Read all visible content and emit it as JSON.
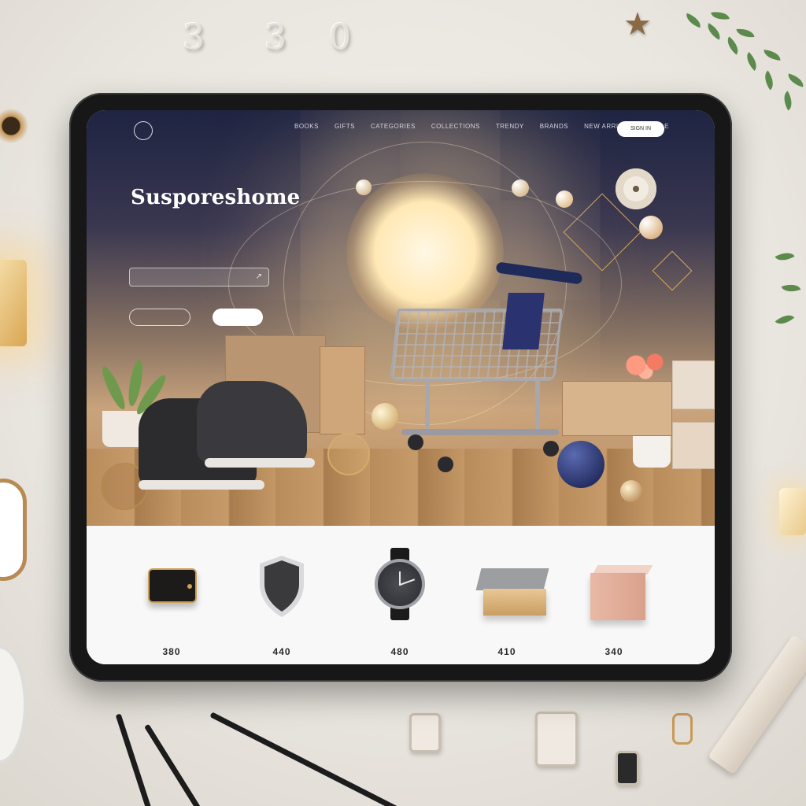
{
  "desk": {
    "digits": [
      "3",
      "3",
      "0"
    ]
  },
  "nav": {
    "logo": "",
    "links": [
      "BOOKS",
      "GIFTS",
      "CATEGORIES",
      "COLLECTIONS",
      "TRENDY",
      "BRANDS",
      "NEW ARRIVALS",
      "SALE"
    ],
    "cta": "SIGN IN"
  },
  "hero": {
    "title": "Susporeshome",
    "subtitle": "",
    "search_placeholder": "",
    "button_outline": "",
    "button_solid": ""
  },
  "products": [
    {
      "icon": "power-bank-icon",
      "name": "",
      "sub": "",
      "price": "380"
    },
    {
      "icon": "shield-icon",
      "name": "",
      "sub": "",
      "price": "440"
    },
    {
      "icon": "watch-icon",
      "name": "",
      "sub": "",
      "price": "480"
    },
    {
      "icon": "gift-box-icon",
      "name": "",
      "sub": "",
      "price": "410"
    },
    {
      "icon": "cube-box-icon",
      "name": "",
      "sub": "",
      "price": "340"
    }
  ],
  "colors": {
    "accent": "#1e2a5a",
    "hero_dark": "#1e2442",
    "hero_warm": "#c9a37c"
  }
}
